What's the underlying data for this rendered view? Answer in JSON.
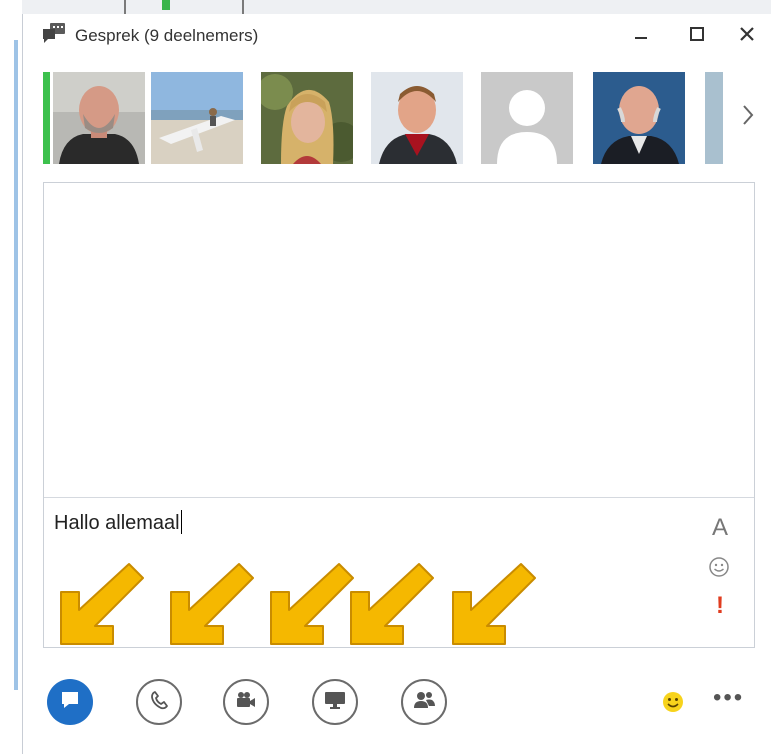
{
  "window": {
    "title": "Gesprek (9 deelnemers)",
    "controls": {
      "minimize": "minimize-icon",
      "maximize": "maximize-icon",
      "close": "close-icon"
    }
  },
  "participants": [
    {
      "name": "participant-1",
      "active": true
    },
    {
      "name": "participant-2",
      "active": false
    },
    {
      "name": "participant-3",
      "active": false
    },
    {
      "name": "participant-4",
      "active": false
    },
    {
      "name": "participant-5",
      "active": false
    },
    {
      "name": "participant-6",
      "active": false
    }
  ],
  "compose": {
    "text": "Hallo allemaal"
  },
  "compose_tools": {
    "font": "A",
    "emoji": "smiley-icon",
    "important": "!"
  },
  "modalities": [
    {
      "name": "im",
      "icon": "chat-bubble-icon",
      "active": true
    },
    {
      "name": "audio",
      "icon": "phone-icon",
      "active": false
    },
    {
      "name": "video",
      "icon": "video-camera-icon",
      "active": false
    },
    {
      "name": "present",
      "icon": "monitor-icon",
      "active": false
    },
    {
      "name": "participants",
      "icon": "people-icon",
      "active": false
    }
  ],
  "bottom_right": {
    "emoji": "smiley-icon",
    "more": "•••"
  },
  "colors": {
    "accent": "#1f6fc6",
    "active_speaker": "#3dc14d",
    "arrow": "#f5b800",
    "important": "#e03c1f"
  }
}
